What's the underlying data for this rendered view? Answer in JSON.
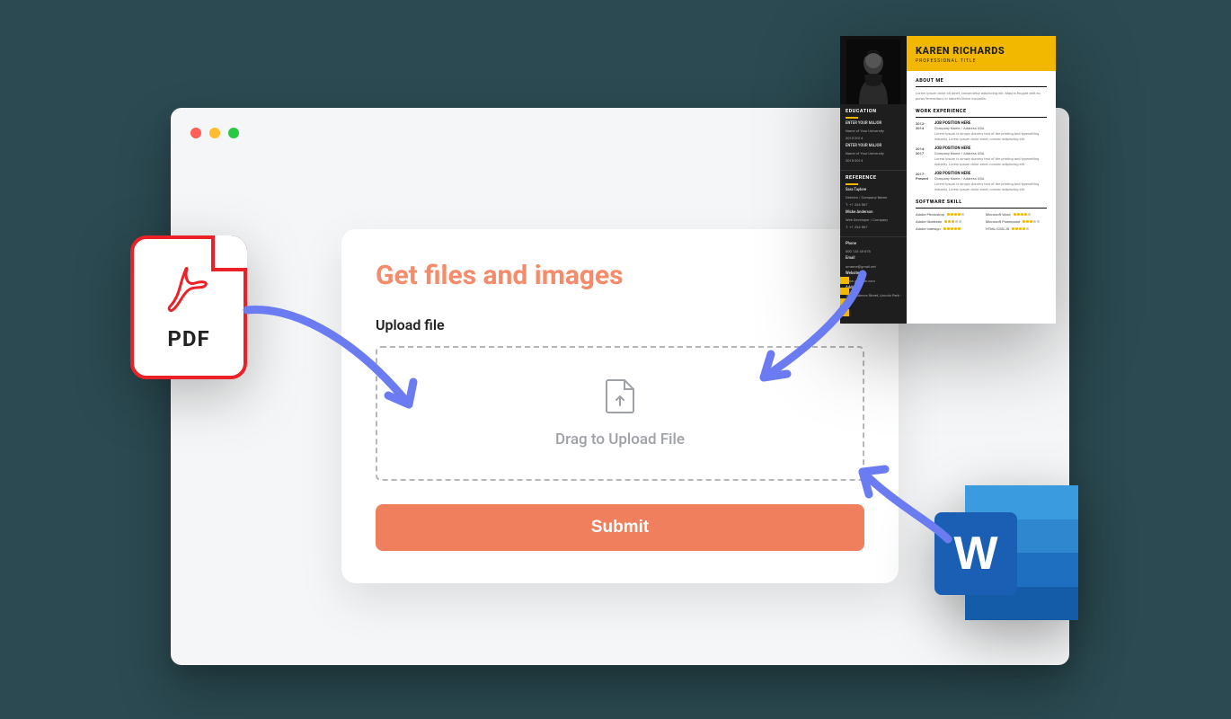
{
  "card": {
    "title": "Get files and images",
    "upload_label": "Upload file",
    "drop_text": "Drag to Upload File",
    "submit_label": "Submit"
  },
  "pdf_tile": {
    "label": "PDF"
  },
  "word_tile": {
    "letter": "W"
  },
  "resume": {
    "name": "KAREN RICHARDS",
    "title": "PROFESSIONAL TITLE",
    "sections": {
      "about": {
        "heading": "ABOUT ME",
        "text": "Lorem ipsum dolor sit amet, consectetur adipiscing elit. Mauris feugiat velit eu purus fermentum, in lobortis libero convallis."
      },
      "work": {
        "heading": "WORK EXPERIENCE",
        "items": [
          {
            "dates": "2012-2014",
            "position": "JOB POSITION HERE",
            "company": "Company Name / Address USA",
            "desc": "Lorem ipsum is simply dummy text of the printing and typesetting industry. Lorem ipsum dolor amet, consec adipiscing elit."
          },
          {
            "dates": "2014-2017",
            "position": "JOB POSITION HERE",
            "company": "Company Name / Address USA",
            "desc": "Lorem ipsum is simply dummy text of the printing and typesetting industry. Lorem ipsum dolor amet, consec adipiscing elit."
          },
          {
            "dates": "2017-Present",
            "position": "JOB POSITION HERE",
            "company": "Company Name / Address USA",
            "desc": "Lorem ipsum is simply dummy text of the printing and typesetting industry. Lorem ipsum dolor amet, consec adipiscing elit."
          }
        ]
      },
      "skills": {
        "heading": "SOFTWARE SKILL",
        "left": [
          "Adobe Photoshop",
          "Adobe Illustrator",
          "Adobe Indesign"
        ],
        "right": [
          "Microsoft Word",
          "Microsoft Powerpoint",
          "HTML/CSS/JS"
        ]
      }
    },
    "left_col": {
      "education": {
        "heading": "EDUCATION",
        "items": [
          {
            "major": "ENTER YOUR MAJOR",
            "uni": "Name of Your University",
            "dates": "2010-2014"
          },
          {
            "major": "ENTER YOUR MAJOR",
            "uni": "Name of Your University",
            "dates": "2010-2014"
          }
        ]
      },
      "reference": {
        "heading": "REFERENCE",
        "items": [
          {
            "name": "Sara Taylore",
            "role": "Director / Company Name",
            "phone": "T: +1 234 567"
          },
          {
            "name": "Micke Anderson",
            "role": "Web Developer / Company",
            "phone": "T: +1 234 567"
          }
        ]
      },
      "contact": {
        "phone_label": "Phone",
        "phone": "000 123 45 678",
        "email_label": "Email",
        "email": "urname@gmail.net",
        "website_label": "Website",
        "website": "www.yoursite.com",
        "address_label": "Address",
        "address": "769 Prudence Street, Lincoln Park - MI"
      }
    }
  },
  "colors": {
    "accent": "#f0805d",
    "title": "#f58b6a",
    "pdf_red": "#eb2128",
    "word_blue": "#1b5fb4",
    "resume_yellow": "#f2b800"
  }
}
